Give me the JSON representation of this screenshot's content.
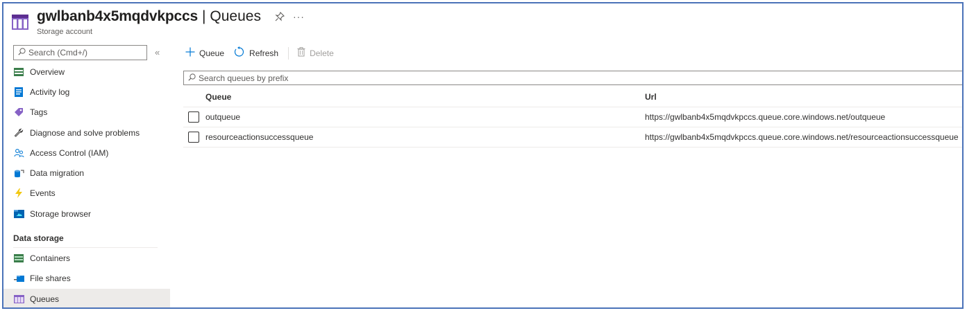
{
  "header": {
    "resource_name": "gwlbanb4x5mqdvkpccs",
    "separator": "|",
    "section": "Queues",
    "subtitle": "Storage account",
    "pin_icon": "pin-icon",
    "more_icon": "more-icon",
    "more_glyph": "···"
  },
  "sidebar": {
    "search_placeholder": "Search (Cmd+/)",
    "collapse_glyph": "«",
    "items": [
      {
        "label": "Overview",
        "icon": "overview-icon"
      },
      {
        "label": "Activity log",
        "icon": "activity-log-icon"
      },
      {
        "label": "Tags",
        "icon": "tag-icon"
      },
      {
        "label": "Diagnose and solve problems",
        "icon": "wrench-icon"
      },
      {
        "label": "Access Control (IAM)",
        "icon": "people-icon"
      },
      {
        "label": "Data migration",
        "icon": "data-migration-icon"
      },
      {
        "label": "Events",
        "icon": "lightning-icon"
      },
      {
        "label": "Storage browser",
        "icon": "storage-browser-icon"
      }
    ],
    "section_title": "Data storage",
    "section_items": [
      {
        "label": "Containers",
        "icon": "containers-icon"
      },
      {
        "label": "File shares",
        "icon": "file-shares-icon"
      },
      {
        "label": "Queues",
        "icon": "queues-icon",
        "active": true
      }
    ]
  },
  "toolbar": {
    "add_label": "Queue",
    "refresh_label": "Refresh",
    "delete_label": "Delete"
  },
  "filter": {
    "placeholder": "Search queues by prefix"
  },
  "table": {
    "columns": [
      "Queue",
      "Url"
    ],
    "rows": [
      {
        "queue": "outqueue",
        "url": "https://gwlbanb4x5mqdvkpccs.queue.core.windows.net/outqueue",
        "checked": false
      },
      {
        "queue": "resourceactionsuccessqueue",
        "url": "https://gwlbanb4x5mqdvkpccs.queue.core.windows.net/resourceactionsuccessqueue",
        "checked": false
      }
    ]
  },
  "colors": {
    "accent": "#0078d4",
    "frame_border": "#4a72b8",
    "active_bg": "#edebe9",
    "queue_icon": "#8661c5"
  }
}
